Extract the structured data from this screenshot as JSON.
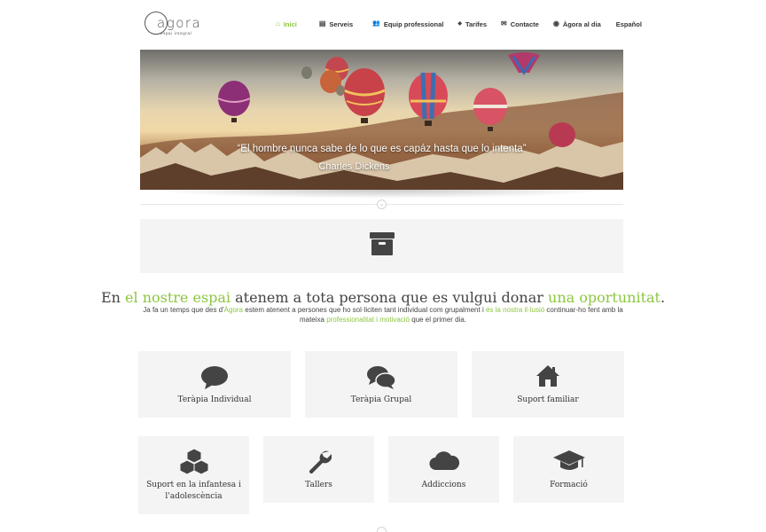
{
  "logo": {
    "name": "agora",
    "tagline": "espai integral"
  },
  "nav": [
    {
      "label": "Inici",
      "icon": "home-icon",
      "glyph": "⌂",
      "active": true
    },
    {
      "label": "Serveis",
      "icon": "list-icon",
      "glyph": "▤"
    },
    {
      "label": "Equip professional",
      "icon": "users-icon",
      "glyph": "👥"
    },
    {
      "label": "Tarifes",
      "icon": "tag-icon",
      "glyph": "◆"
    },
    {
      "label": "Contacte",
      "icon": "envelope-icon",
      "glyph": "✉"
    },
    {
      "label": "Àgora al dia",
      "icon": "globe-icon",
      "glyph": "◉"
    },
    {
      "label": "Español",
      "icon": "",
      "glyph": ""
    }
  ],
  "slider": {
    "quote": "“El hombre nunca sabe de lo que es capáz hasta que lo intenta”",
    "author": "Charles Dickens"
  },
  "intro": {
    "title_parts": [
      "En ",
      "el nostre espai",
      " atenem a tota persona que es vulgui donar ",
      "una oportunitat",
      "."
    ],
    "text_parts": [
      "Ja fa un temps que des d'",
      "Àgora",
      " estem atenent a persones que ho sol·liciten tant individual com grupalment i ",
      "és la nostra il·lusió",
      " continuar-ho fent amb la mateixa ",
      "professionalitat i motivació",
      " que el primer dia."
    ]
  },
  "services": [
    {
      "label": "Teràpia Individual",
      "icon": "speech-bubble-icon"
    },
    {
      "label": "Teràpia Grupal",
      "icon": "speech-bubbles-icon"
    },
    {
      "label": "Suport familiar",
      "icon": "house-icon"
    },
    {
      "label": "Suport en la infantesa i l'adolescència",
      "icon": "cubes-icon"
    },
    {
      "label": "Tallers",
      "icon": "wrench-icon"
    },
    {
      "label": "Addiccions",
      "icon": "cloud-icon"
    },
    {
      "label": "Formació",
      "icon": "graduation-cap-icon"
    }
  ],
  "colors": {
    "accent": "#8cc63f",
    "box": "#f4f4f4",
    "icon": "#444444"
  }
}
